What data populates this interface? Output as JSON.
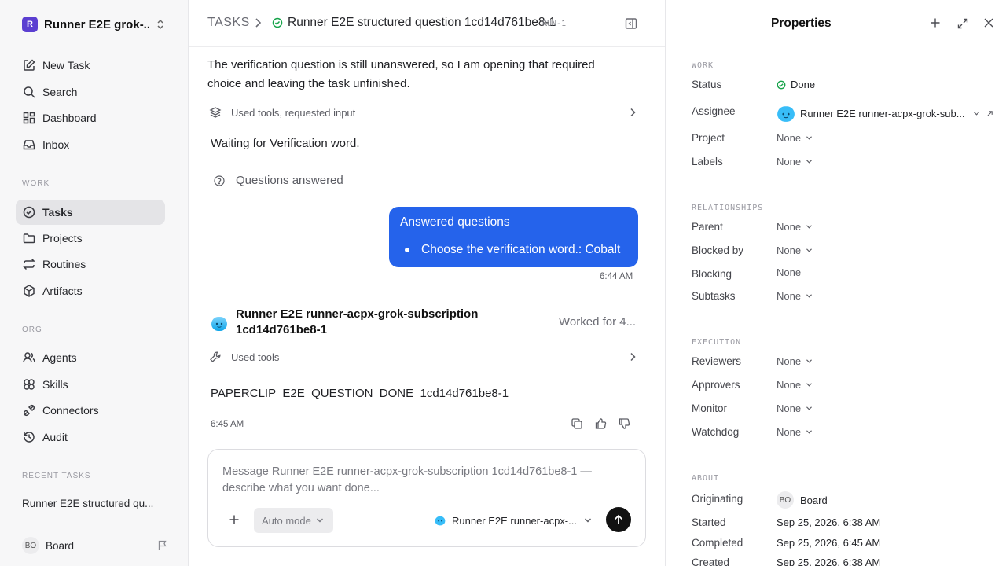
{
  "workspace": {
    "name": "Runner E2E grok-...",
    "logo_letter": "R"
  },
  "nav": {
    "new_task": "New Task",
    "search": "Search",
    "dashboard": "Dashboard",
    "inbox": "Inbox",
    "work_section": "WORK",
    "tasks": "Tasks",
    "projects": "Projects",
    "routines": "Routines",
    "artifacts": "Artifacts",
    "org_section": "ORG",
    "agents": "Agents",
    "skills": "Skills",
    "connectors": "Connectors",
    "audit": "Audit",
    "recent_section": "RECENT TASKS",
    "recent_item": "Runner E2E structured qu..."
  },
  "user": {
    "initials": "BO",
    "name": "Board"
  },
  "header": {
    "root": "TASKS",
    "title": "Runner E2E structured question 1cd14d761be8-1",
    "run_tag": "RUN-1"
  },
  "thread": {
    "intro_text": "The verification question is still unanswered, so I am opening that required choice and leaving the task unfinished.",
    "tools_requested": "Used tools, requested input",
    "waiting": "Waiting for Verification word.",
    "questions_answered": "Questions answered",
    "bubble": {
      "title": "Answered questions",
      "item": "Choose the verification word.: Cobalt"
    },
    "bubble_time": "6:44 AM",
    "agent_name": "Runner E2E runner-acpx-grok-subscription 1cd14d761be8-1",
    "worked_for": "Worked for 4...",
    "tools_used": "Used tools",
    "final_text": "PAPERCLIP_E2E_QUESTION_DONE_1cd14d761be8-1",
    "final_time": "6:45 AM"
  },
  "composer": {
    "placeholder": "Message Runner E2E runner-acpx-grok-subscription 1cd14d761be8-1 — describe what you want done...",
    "mode": "Auto mode",
    "agent": "Runner E2E runner-acpx-..."
  },
  "properties": {
    "title": "Properties",
    "work_section": "WORK",
    "status_label": "Status",
    "status_value": "Done",
    "assignee_label": "Assignee",
    "assignee_value": "Runner E2E runner-acpx-grok-sub...",
    "project_label": "Project",
    "project_value": "None",
    "labels_label": "Labels",
    "labels_value": "None",
    "rel_section": "RELATIONSHIPS",
    "parent_label": "Parent",
    "parent_value": "None",
    "blocked_label": "Blocked by",
    "blocked_value": "None",
    "blocking_label": "Blocking",
    "blocking_value": "None",
    "subtasks_label": "Subtasks",
    "subtasks_value": "None",
    "exec_section": "EXECUTION",
    "reviewers_label": "Reviewers",
    "reviewers_value": "None",
    "approvers_label": "Approvers",
    "approvers_value": "None",
    "monitor_label": "Monitor",
    "monitor_value": "None",
    "watchdog_label": "Watchdog",
    "watchdog_value": "None",
    "about_section": "ABOUT",
    "originating_label": "Originating",
    "originating_initials": "BO",
    "originating_value": "Board",
    "started_label": "Started",
    "started_value": "Sep 25, 2026, 6:38 AM",
    "completed_label": "Completed",
    "completed_value": "Sep 25, 2026, 6:45 AM",
    "created_label": "Created",
    "created_value": "Sep 25, 2026, 6:38 AM"
  },
  "colors": {
    "accent_blue": "#2563eb",
    "done_green": "#16a34a",
    "workspace_purple": "#5b3fd1"
  }
}
